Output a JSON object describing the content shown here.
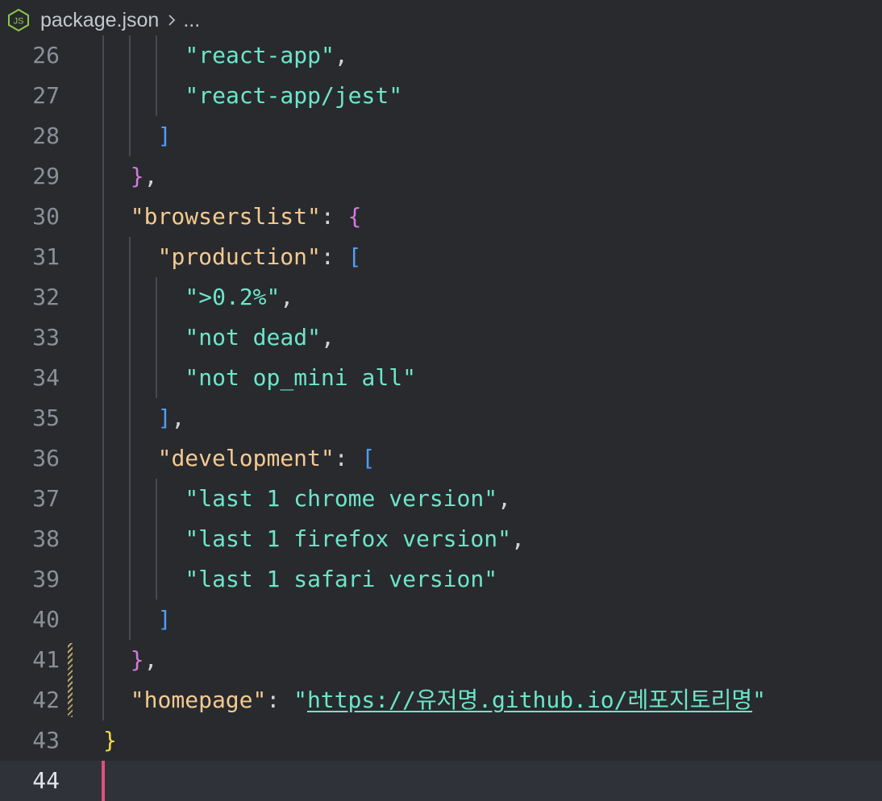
{
  "breadcrumb": {
    "file_icon": "nodejs-icon",
    "file_name": "package.json",
    "separator_icon": "chevron-right-icon",
    "more": "..."
  },
  "lines": [
    {
      "num": "26",
      "tokens": [
        {
          "t": "\"react-app\"",
          "c": "s"
        },
        {
          "t": ",",
          "c": "p"
        }
      ]
    },
    {
      "num": "27",
      "tokens": [
        {
          "t": "\"react-app/jest\"",
          "c": "s"
        }
      ]
    },
    {
      "num": "28",
      "tokens": [
        {
          "t": "]",
          "c": "b3"
        }
      ]
    },
    {
      "num": "29",
      "tokens": [
        {
          "t": "}",
          "c": "b2"
        },
        {
          "t": ",",
          "c": "p"
        }
      ]
    },
    {
      "num": "30",
      "tokens": [
        {
          "t": "\"browserslist\"",
          "c": "k"
        },
        {
          "t": ": ",
          "c": "p"
        },
        {
          "t": "{",
          "c": "b2"
        }
      ]
    },
    {
      "num": "31",
      "tokens": [
        {
          "t": "\"production\"",
          "c": "k"
        },
        {
          "t": ": ",
          "c": "p"
        },
        {
          "t": "[",
          "c": "b3"
        }
      ]
    },
    {
      "num": "32",
      "tokens": [
        {
          "t": "\">0.2%\"",
          "c": "s"
        },
        {
          "t": ",",
          "c": "p"
        }
      ]
    },
    {
      "num": "33",
      "tokens": [
        {
          "t": "\"not dead\"",
          "c": "s"
        },
        {
          "t": ",",
          "c": "p"
        }
      ]
    },
    {
      "num": "34",
      "tokens": [
        {
          "t": "\"not op_mini all\"",
          "c": "s"
        }
      ]
    },
    {
      "num": "35",
      "tokens": [
        {
          "t": "]",
          "c": "b3"
        },
        {
          "t": ",",
          "c": "p"
        }
      ]
    },
    {
      "num": "36",
      "tokens": [
        {
          "t": "\"development\"",
          "c": "k"
        },
        {
          "t": ": ",
          "c": "p"
        },
        {
          "t": "[",
          "c": "b3"
        }
      ]
    },
    {
      "num": "37",
      "tokens": [
        {
          "t": "\"last 1 chrome version\"",
          "c": "s"
        },
        {
          "t": ",",
          "c": "p"
        }
      ]
    },
    {
      "num": "38",
      "tokens": [
        {
          "t": "\"last 1 firefox version\"",
          "c": "s"
        },
        {
          "t": ",",
          "c": "p"
        }
      ]
    },
    {
      "num": "39",
      "tokens": [
        {
          "t": "\"last 1 safari version\"",
          "c": "s"
        }
      ]
    },
    {
      "num": "40",
      "tokens": [
        {
          "t": "]",
          "c": "b3"
        }
      ]
    },
    {
      "num": "41",
      "tokens": [
        {
          "t": "}",
          "c": "b2"
        },
        {
          "t": ",",
          "c": "p"
        }
      ]
    },
    {
      "num": "42",
      "tokens": [
        {
          "t": "\"homepage\"",
          "c": "k"
        },
        {
          "t": ": ",
          "c": "p"
        },
        {
          "t": "\"",
          "c": "s"
        },
        {
          "t": "https://유저명.github.io/레포지토리명",
          "c": "u"
        },
        {
          "t": "\"",
          "c": "s"
        }
      ]
    },
    {
      "num": "43",
      "tokens": [
        {
          "t": "}",
          "c": "b1"
        }
      ]
    },
    {
      "num": "44",
      "tokens": [],
      "current": true
    }
  ]
}
